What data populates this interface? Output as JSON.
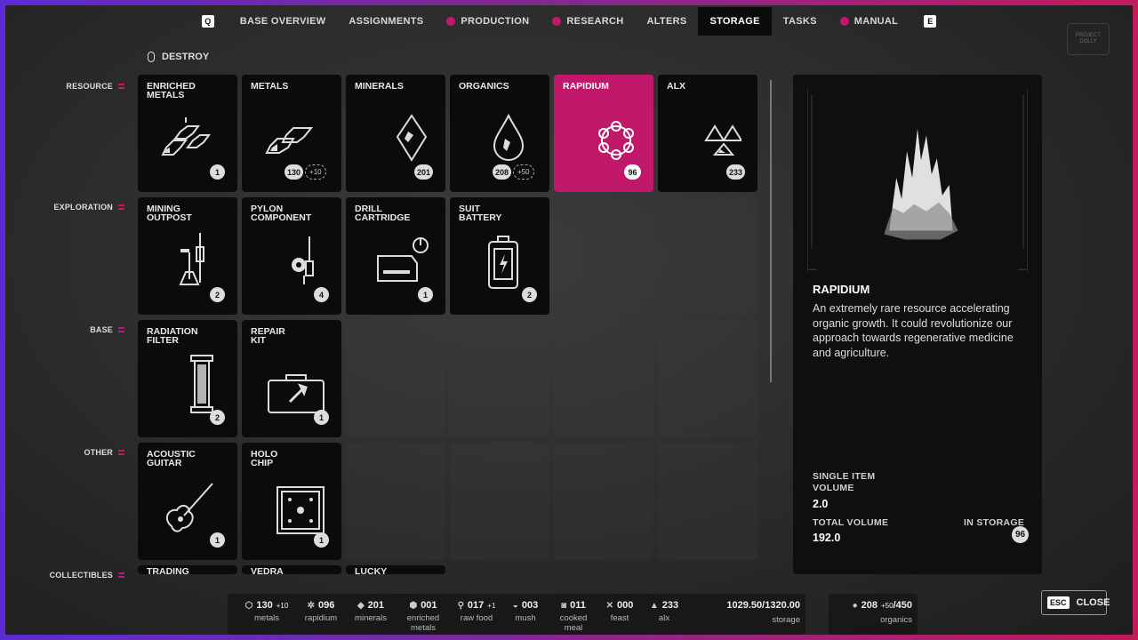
{
  "nav": {
    "left_key": "Q",
    "right_key": "E",
    "tabs": [
      {
        "label": "BASE OVERVIEW",
        "dot": false,
        "active": false
      },
      {
        "label": "ASSIGNMENTS",
        "dot": false,
        "active": false
      },
      {
        "label": "PRODUCTION",
        "dot": true,
        "active": false
      },
      {
        "label": "RESEARCH",
        "dot": true,
        "active": false
      },
      {
        "label": "ALTERS",
        "dot": false,
        "active": false
      },
      {
        "label": "STORAGE",
        "dot": false,
        "active": true
      },
      {
        "label": "TASKS",
        "dot": false,
        "active": false
      },
      {
        "label": "MANUAL",
        "dot": true,
        "active": false
      }
    ]
  },
  "logo_text": "PROJECT DOLLY",
  "destroy_label": "DESTROY",
  "categories": {
    "resource": "RESOURCE",
    "exploration": "EXPLORATION",
    "base": "BASE",
    "other": "OTHER",
    "collectibles": "COLLECTIBLES"
  },
  "items": {
    "enriched_metals": {
      "name": "ENRICHED\nMETALS",
      "count": "1"
    },
    "metals": {
      "name": "METALS",
      "count": "130",
      "bonus": "+10"
    },
    "minerals": {
      "name": "MINERALS",
      "count": "201"
    },
    "organics": {
      "name": "ORGANICS",
      "count": "208",
      "bonus": "+50"
    },
    "rapidium": {
      "name": "RAPIDIUM",
      "count": "96"
    },
    "alx": {
      "name": "ALX",
      "count": "233"
    },
    "mining_outpost": {
      "name": "MINING\nOUTPOST",
      "count": "2"
    },
    "pylon_component": {
      "name": "PYLON\nCOMPONENT",
      "count": "4"
    },
    "drill_cartridge": {
      "name": "DRILL\nCARTRIDGE",
      "count": "1"
    },
    "suit_battery": {
      "name": "SUIT\nBATTERY",
      "count": "2"
    },
    "radiation_filter": {
      "name": "RADIATION\nFILTER",
      "count": "2"
    },
    "repair_kit": {
      "name": "REPAIR\nKIT",
      "count": "1"
    },
    "acoustic_guitar": {
      "name": "ACOUSTIC\nGUITAR",
      "count": "1"
    },
    "holo_chip": {
      "name": "HOLO\nCHIP",
      "count": "1"
    },
    "trading": {
      "name": "TRADING"
    },
    "vedra": {
      "name": "VEDRA"
    },
    "lucky": {
      "name": "LUCKY"
    }
  },
  "detail": {
    "title": "RAPIDIUM",
    "description": "An extremely rare resource accelerating organic growth. It could revolutionize our approach towards regenerative medicine and agriculture.",
    "single_label": "SINGLE ITEM\nVOLUME",
    "single_value": "2.0",
    "total_label": "TOTAL VOLUME",
    "total_value": "192.0",
    "in_storage_label": "IN STORAGE",
    "in_storage_value": "96"
  },
  "bottom": {
    "metals": {
      "value": "130",
      "bonus": "+10",
      "label": "metals"
    },
    "rapidium": {
      "value": "096",
      "label": "rapidium"
    },
    "minerals": {
      "value": "201",
      "label": "minerals"
    },
    "enriched": {
      "value": "001",
      "label": "enriched\nmetals"
    },
    "raw_food": {
      "value": "017",
      "bonus": "+1",
      "label": "raw food"
    },
    "mush": {
      "value": "003",
      "label": "mush"
    },
    "cooked": {
      "value": "011",
      "label": "cooked\nmeal"
    },
    "feast": {
      "value": "000",
      "label": "feast"
    },
    "alx": {
      "value": "233",
      "label": "alx"
    },
    "storage": {
      "value": "1029.50/1320.00",
      "label": "storage"
    },
    "organics": {
      "value": "208",
      "bonus": "+50",
      "max": "/450",
      "label": "organics"
    }
  },
  "close": {
    "key": "ESC",
    "label": "CLOSE"
  },
  "accent": "#c2186c"
}
